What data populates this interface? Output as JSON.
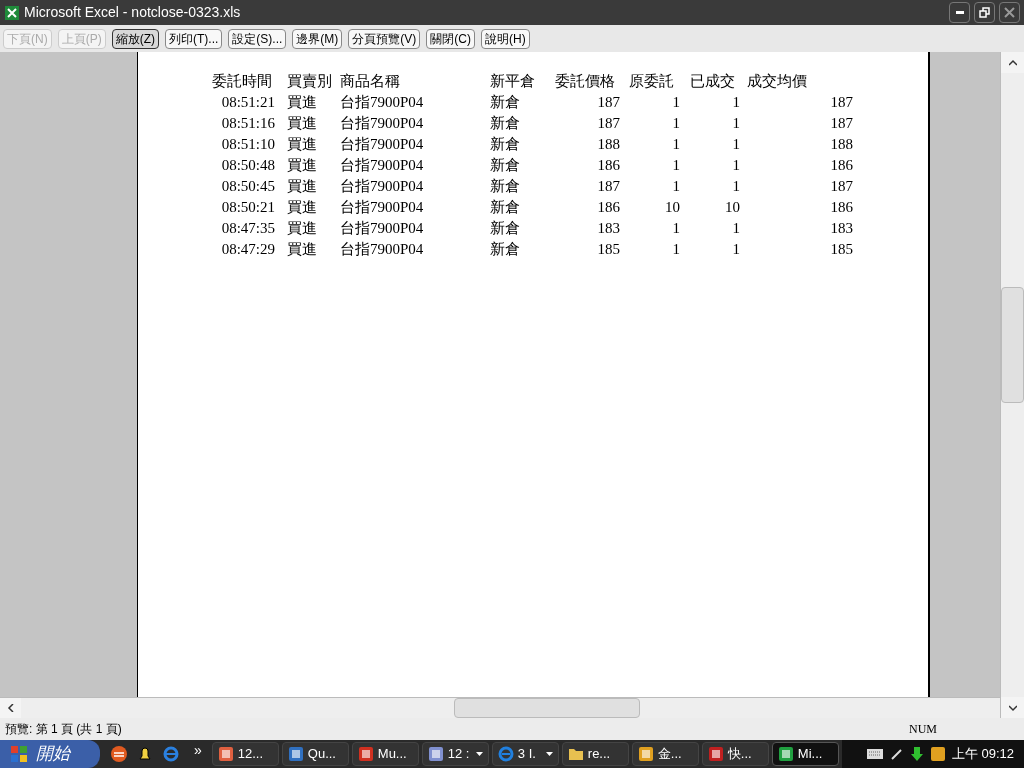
{
  "window": {
    "title": "Microsoft Excel - notclose-0323.xls"
  },
  "toolbar": [
    {
      "label": "下頁(N)",
      "disabled": true,
      "pressed": false
    },
    {
      "label": "上頁(P)",
      "disabled": true,
      "pressed": false
    },
    {
      "label": "縮放(Z)",
      "disabled": false,
      "pressed": true
    },
    {
      "label": "列印(T)...",
      "disabled": false,
      "pressed": false
    },
    {
      "label": "設定(S)...",
      "disabled": false,
      "pressed": false
    },
    {
      "label": "邊界(M)",
      "disabled": false,
      "pressed": false
    },
    {
      "label": "分頁預覽(V)",
      "disabled": false,
      "pressed": false
    },
    {
      "label": "關閉(C)",
      "disabled": false,
      "pressed": false
    },
    {
      "label": "說明(H)",
      "disabled": false,
      "pressed": false
    }
  ],
  "table": {
    "columns": [
      "委託時間",
      "買賣別",
      "商品名稱",
      "新平倉",
      "委託價格",
      "原委託",
      "已成交",
      "成交均價"
    ],
    "rows": [
      [
        "08:51:21",
        "買進",
        "台指7900P04",
        "新倉",
        "187",
        "1",
        "1",
        "187"
      ],
      [
        "08:51:16",
        "買進",
        "台指7900P04",
        "新倉",
        "187",
        "1",
        "1",
        "187"
      ],
      [
        "08:51:10",
        "買進",
        "台指7900P04",
        "新倉",
        "188",
        "1",
        "1",
        "188"
      ],
      [
        "08:50:48",
        "買進",
        "台指7900P04",
        "新倉",
        "186",
        "1",
        "1",
        "186"
      ],
      [
        "08:50:45",
        "買進",
        "台指7900P04",
        "新倉",
        "187",
        "1",
        "1",
        "187"
      ],
      [
        "08:50:21",
        "買進",
        "台指7900P04",
        "新倉",
        "186",
        "10",
        "10",
        "186"
      ],
      [
        "08:47:35",
        "買進",
        "台指7900P04",
        "新倉",
        "183",
        "1",
        "1",
        "183"
      ],
      [
        "08:47:29",
        "買進",
        "台指7900P04",
        "新倉",
        "185",
        "1",
        "1",
        "185"
      ]
    ]
  },
  "status_bar": {
    "left": "預覽: 第 1 頁 (共 1 頁)",
    "indicator": "NUM"
  },
  "taskbar": {
    "start": "開始",
    "more": "»",
    "tasks": [
      {
        "label": "12...",
        "selected": false,
        "group": false
      },
      {
        "label": "Qu...",
        "selected": false,
        "group": false
      },
      {
        "label": "Mu...",
        "selected": false,
        "group": false
      },
      {
        "label": "12 :",
        "selected": false,
        "group": true
      },
      {
        "label": "3 I.",
        "selected": false,
        "group": true
      },
      {
        "label": "re...",
        "selected": false,
        "group": false
      },
      {
        "label": "金...",
        "selected": false,
        "group": false
      },
      {
        "label": "快...",
        "selected": false,
        "group": false
      },
      {
        "label": "Mi...",
        "selected": true,
        "group": false
      }
    ],
    "clock": "上午 09:12"
  }
}
